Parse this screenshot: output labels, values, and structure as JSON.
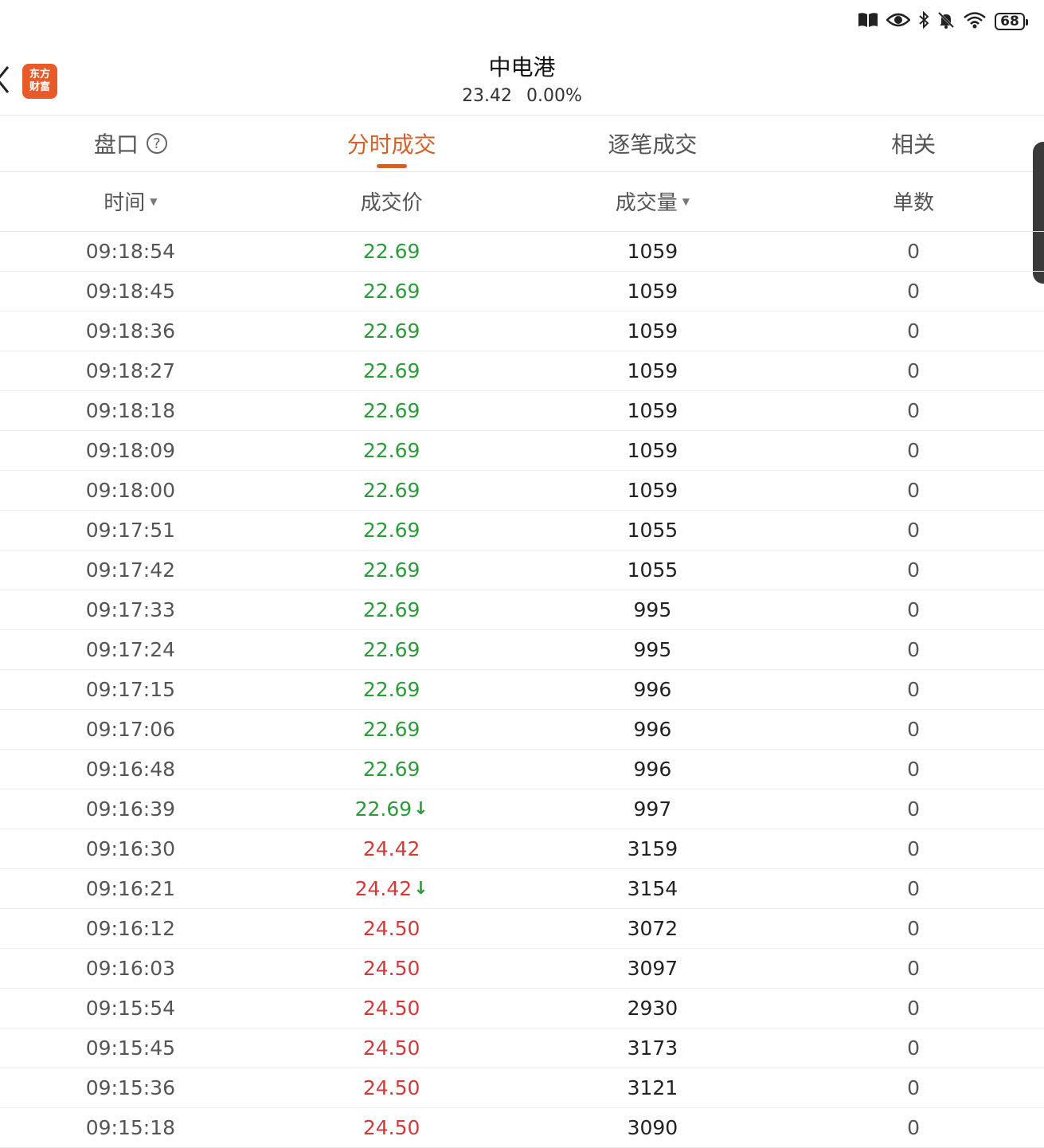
{
  "status": {
    "battery": "68"
  },
  "header": {
    "logo_line1": "东方",
    "logo_line2": "财富",
    "stock_name": "中电港",
    "price": "23.42",
    "change": "0.00%"
  },
  "tabs": [
    {
      "label": "盘口"
    },
    {
      "label": "分时成交"
    },
    {
      "label": "逐笔成交"
    },
    {
      "label": "相关"
    }
  ],
  "columns": {
    "time": "时间",
    "price": "成交价",
    "volume": "成交量",
    "count": "单数"
  },
  "colors": {
    "accent": "#d0632c",
    "down": "#2e9a3c",
    "up": "#d03a3a"
  },
  "rows": [
    {
      "time": "09:18:54",
      "price": "22.69",
      "dir": "down",
      "arrow": false,
      "volume": "1059",
      "count": "0"
    },
    {
      "time": "09:18:45",
      "price": "22.69",
      "dir": "down",
      "arrow": false,
      "volume": "1059",
      "count": "0"
    },
    {
      "time": "09:18:36",
      "price": "22.69",
      "dir": "down",
      "arrow": false,
      "volume": "1059",
      "count": "0"
    },
    {
      "time": "09:18:27",
      "price": "22.69",
      "dir": "down",
      "arrow": false,
      "volume": "1059",
      "count": "0"
    },
    {
      "time": "09:18:18",
      "price": "22.69",
      "dir": "down",
      "arrow": false,
      "volume": "1059",
      "count": "0"
    },
    {
      "time": "09:18:09",
      "price": "22.69",
      "dir": "down",
      "arrow": false,
      "volume": "1059",
      "count": "0"
    },
    {
      "time": "09:18:00",
      "price": "22.69",
      "dir": "down",
      "arrow": false,
      "volume": "1059",
      "count": "0"
    },
    {
      "time": "09:17:51",
      "price": "22.69",
      "dir": "down",
      "arrow": false,
      "volume": "1055",
      "count": "0"
    },
    {
      "time": "09:17:42",
      "price": "22.69",
      "dir": "down",
      "arrow": false,
      "volume": "1055",
      "count": "0"
    },
    {
      "time": "09:17:33",
      "price": "22.69",
      "dir": "down",
      "arrow": false,
      "volume": "995",
      "count": "0"
    },
    {
      "time": "09:17:24",
      "price": "22.69",
      "dir": "down",
      "arrow": false,
      "volume": "995",
      "count": "0"
    },
    {
      "time": "09:17:15",
      "price": "22.69",
      "dir": "down",
      "arrow": false,
      "volume": "996",
      "count": "0"
    },
    {
      "time": "09:17:06",
      "price": "22.69",
      "dir": "down",
      "arrow": false,
      "volume": "996",
      "count": "0"
    },
    {
      "time": "09:16:48",
      "price": "22.69",
      "dir": "down",
      "arrow": false,
      "volume": "996",
      "count": "0"
    },
    {
      "time": "09:16:39",
      "price": "22.69",
      "dir": "down",
      "arrow": true,
      "volume": "997",
      "count": "0"
    },
    {
      "time": "09:16:30",
      "price": "24.42",
      "dir": "up",
      "arrow": false,
      "volume": "3159",
      "count": "0"
    },
    {
      "time": "09:16:21",
      "price": "24.42",
      "dir": "up",
      "arrow": true,
      "volume": "3154",
      "count": "0"
    },
    {
      "time": "09:16:12",
      "price": "24.50",
      "dir": "up",
      "arrow": false,
      "volume": "3072",
      "count": "0"
    },
    {
      "time": "09:16:03",
      "price": "24.50",
      "dir": "up",
      "arrow": false,
      "volume": "3097",
      "count": "0"
    },
    {
      "time": "09:15:54",
      "price": "24.50",
      "dir": "up",
      "arrow": false,
      "volume": "2930",
      "count": "0"
    },
    {
      "time": "09:15:45",
      "price": "24.50",
      "dir": "up",
      "arrow": false,
      "volume": "3173",
      "count": "0"
    },
    {
      "time": "09:15:36",
      "price": "24.50",
      "dir": "up",
      "arrow": false,
      "volume": "3121",
      "count": "0"
    },
    {
      "time": "09:15:18",
      "price": "24.50",
      "dir": "up",
      "arrow": false,
      "volume": "3090",
      "count": "0"
    }
  ]
}
